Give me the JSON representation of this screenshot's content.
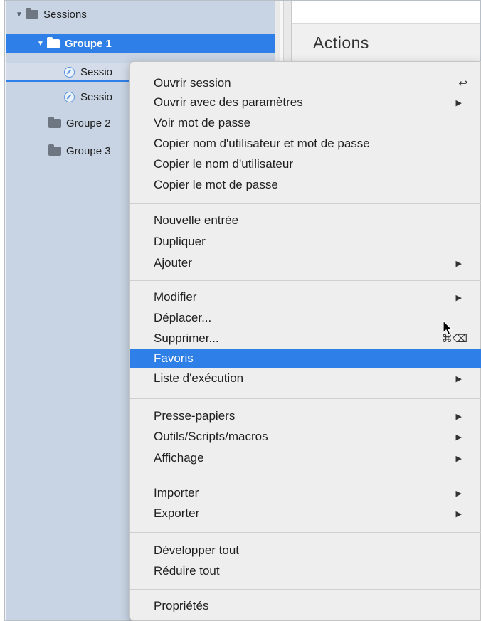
{
  "tree": {
    "root": "Sessions",
    "group1": "Groupe 1",
    "session_a": "Sessio",
    "session_b": "Sessio",
    "group2": "Groupe 2",
    "group3": "Groupe 3"
  },
  "main": {
    "title": "Actions"
  },
  "menu": {
    "section1": [
      {
        "label": "Ouvrir session",
        "shortcut": "↩"
      },
      {
        "label": "Ouvrir avec des paramètres",
        "submenu": "▶"
      },
      {
        "label": "Voir mot de passe"
      },
      {
        "label": "Copier nom d'utilisateur et mot de passe"
      },
      {
        "label": "Copier le nom d'utilisateur"
      },
      {
        "label": "Copier le mot de passe"
      }
    ],
    "section2": [
      {
        "label": "Nouvelle entrée"
      },
      {
        "label": "Dupliquer"
      },
      {
        "label": "Ajouter",
        "submenu": "▶"
      }
    ],
    "section3": [
      {
        "label": "Modifier",
        "submenu": "▶"
      },
      {
        "label": "Déplacer..."
      },
      {
        "label": "Supprimer...",
        "shortcut": "⌘⌫"
      },
      {
        "label": "Favoris"
      },
      {
        "label": "Liste d'exécution",
        "submenu": "▶"
      }
    ],
    "section4": [
      {
        "label": "Presse-papiers",
        "submenu": "▶"
      },
      {
        "label": "Outils/Scripts/macros",
        "submenu": "▶"
      },
      {
        "label": "Affichage",
        "submenu": "▶"
      }
    ],
    "section5": [
      {
        "label": "Importer",
        "submenu": "▶"
      },
      {
        "label": "Exporter",
        "submenu": "▶"
      }
    ],
    "section6": [
      {
        "label": "Développer tout"
      },
      {
        "label": "Réduire tout"
      }
    ],
    "section7": [
      {
        "label": "Propriétés"
      }
    ]
  },
  "colors": {
    "highlight": "#2f7fe8",
    "sidebar": "#c8d4e3"
  }
}
